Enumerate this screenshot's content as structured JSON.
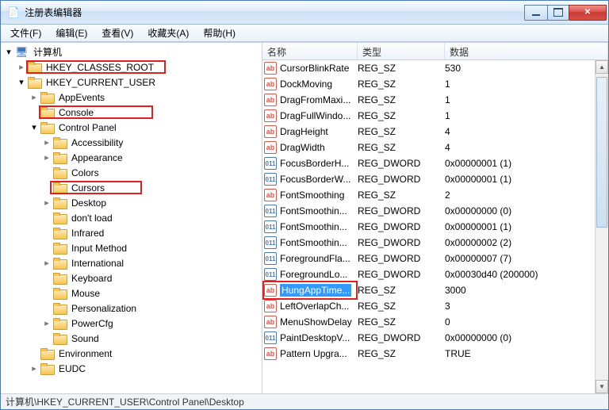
{
  "window": {
    "title": "注册表编辑器"
  },
  "menu": {
    "file": "文件(F)",
    "edit": "编辑(E)",
    "view": "查看(V)",
    "favorites": "收藏夹(A)",
    "help": "帮助(H)"
  },
  "columns": {
    "name": "名称",
    "type": "类型",
    "data": "数据"
  },
  "tree": {
    "root": "计算机",
    "hkcr": "HKEY_CLASSES_ROOT",
    "hkcu": "HKEY_CURRENT_USER",
    "appevents": "AppEvents",
    "console": "Console",
    "controlpanel": "Control Panel",
    "accessibility": "Accessibility",
    "appearance": "Appearance",
    "colors": "Colors",
    "cursors": "Cursors",
    "desktop": "Desktop",
    "dontload": "don't load",
    "infrared": "Infrared",
    "inputmethod": "Input Method",
    "international": "International",
    "keyboard": "Keyboard",
    "mouse": "Mouse",
    "personalization": "Personalization",
    "powercfg": "PowerCfg",
    "sound": "Sound",
    "environment": "Environment",
    "eudc": "EUDC"
  },
  "values": [
    {
      "name": "CursorBlinkRate",
      "type": "REG_SZ",
      "data": "530",
      "icon": "sz"
    },
    {
      "name": "DockMoving",
      "type": "REG_SZ",
      "data": "1",
      "icon": "sz"
    },
    {
      "name": "DragFromMaxi...",
      "type": "REG_SZ",
      "data": "1",
      "icon": "sz"
    },
    {
      "name": "DragFullWindo...",
      "type": "REG_SZ",
      "data": "1",
      "icon": "sz"
    },
    {
      "name": "DragHeight",
      "type": "REG_SZ",
      "data": "4",
      "icon": "sz"
    },
    {
      "name": "DragWidth",
      "type": "REG_SZ",
      "data": "4",
      "icon": "sz"
    },
    {
      "name": "FocusBorderH...",
      "type": "REG_DWORD",
      "data": "0x00000001 (1)",
      "icon": "dw"
    },
    {
      "name": "FocusBorderW...",
      "type": "REG_DWORD",
      "data": "0x00000001 (1)",
      "icon": "dw"
    },
    {
      "name": "FontSmoothing",
      "type": "REG_SZ",
      "data": "2",
      "icon": "sz"
    },
    {
      "name": "FontSmoothin...",
      "type": "REG_DWORD",
      "data": "0x00000000 (0)",
      "icon": "dw"
    },
    {
      "name": "FontSmoothin...",
      "type": "REG_DWORD",
      "data": "0x00000001 (1)",
      "icon": "dw"
    },
    {
      "name": "FontSmoothin...",
      "type": "REG_DWORD",
      "data": "0x00000002 (2)",
      "icon": "dw"
    },
    {
      "name": "ForegroundFla...",
      "type": "REG_DWORD",
      "data": "0x00000007 (7)",
      "icon": "dw"
    },
    {
      "name": "ForegroundLo...",
      "type": "REG_DWORD",
      "data": "0x00030d40 (200000)",
      "icon": "dw"
    },
    {
      "name": "HungAppTime...",
      "type": "REG_SZ",
      "data": "3000",
      "icon": "sz",
      "selected": true
    },
    {
      "name": "LeftOverlapCh...",
      "type": "REG_SZ",
      "data": "3",
      "icon": "sz"
    },
    {
      "name": "MenuShowDelay",
      "type": "REG_SZ",
      "data": "0",
      "icon": "sz"
    },
    {
      "name": "PaintDesktopV...",
      "type": "REG_DWORD",
      "data": "0x00000000 (0)",
      "icon": "dw"
    },
    {
      "name": "Pattern Upgra...",
      "type": "REG_SZ",
      "data": "TRUE",
      "icon": "sz"
    }
  ],
  "statusbar": "计算机\\HKEY_CURRENT_USER\\Control Panel\\Desktop"
}
